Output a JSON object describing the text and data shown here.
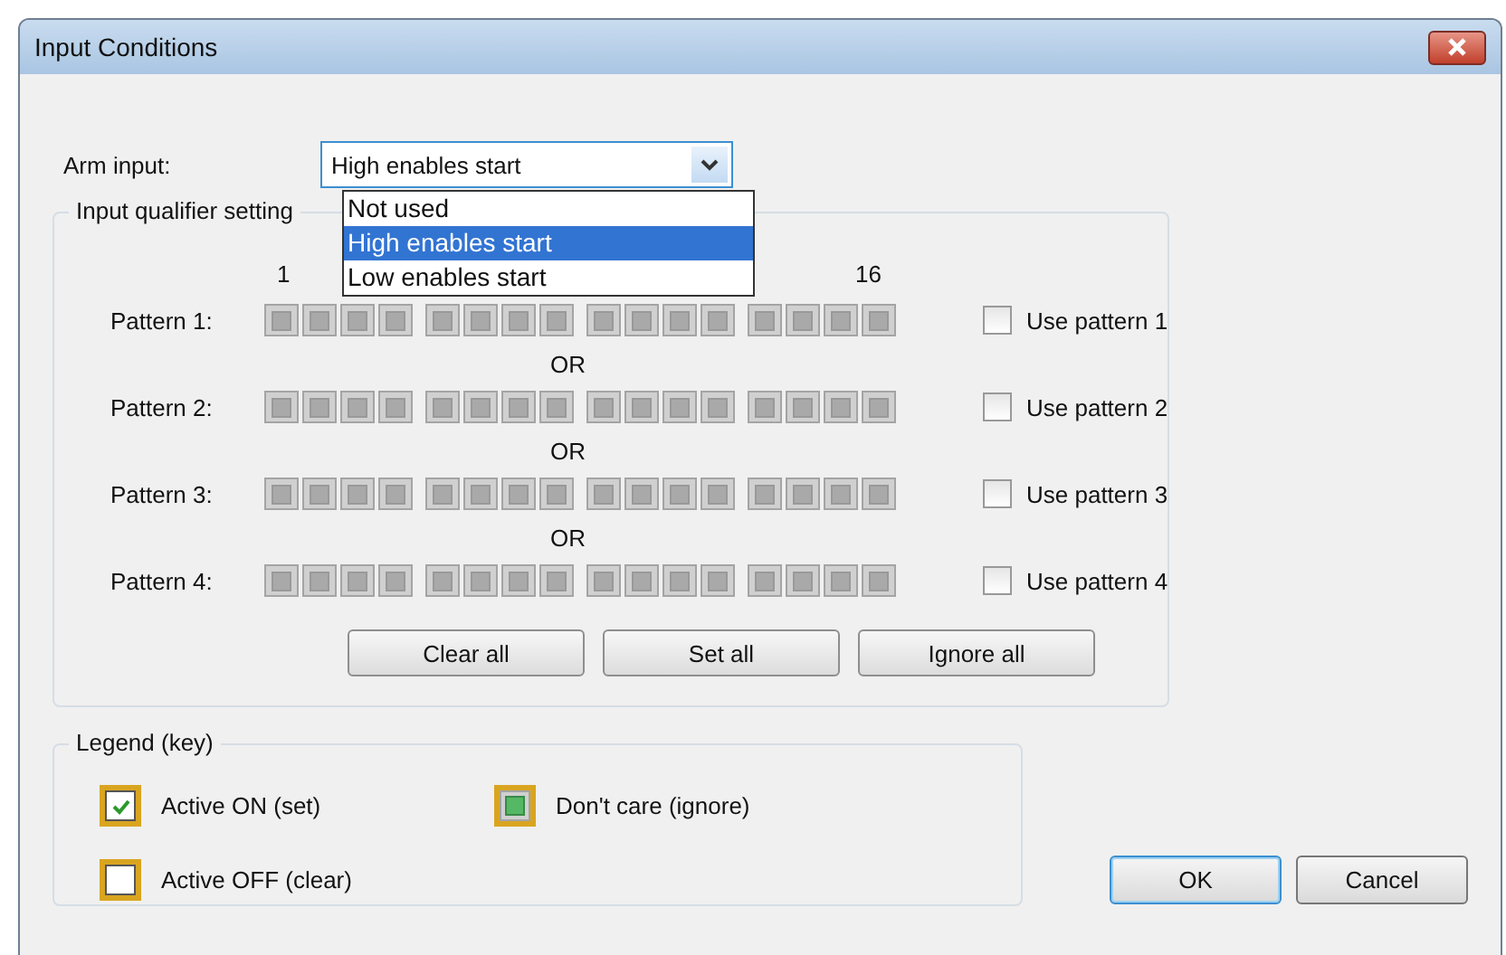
{
  "window": {
    "title": "Input Conditions"
  },
  "arm_input": {
    "label": "Arm input:",
    "value": "High enables start",
    "expanded": true,
    "options": [
      {
        "label": "Not used",
        "selected": false
      },
      {
        "label": "High enables start",
        "selected": true
      },
      {
        "label": "Low enables start",
        "selected": false
      }
    ]
  },
  "qualifier": {
    "title": "Input qualifier setting",
    "first_bit": "1",
    "last_bit": "16",
    "patterns": [
      {
        "label": "Pattern 1:",
        "use_label": "Use pattern 1",
        "checked": false,
        "cells": [
          {
            "kind": "ignore"
          },
          {
            "kind": "ignore"
          },
          {
            "kind": "ignore"
          },
          {
            "kind": "ignore"
          },
          {
            "kind": "ignore"
          },
          {
            "kind": "ignore"
          },
          {
            "kind": "ignore"
          },
          {
            "kind": "ignore"
          },
          {
            "kind": "ignore"
          },
          {
            "kind": "ignore"
          },
          {
            "kind": "ignore"
          },
          {
            "kind": "ignore"
          },
          {
            "kind": "ignore"
          },
          {
            "kind": "ignore"
          },
          {
            "kind": "ignore"
          },
          {
            "kind": "ignore"
          }
        ]
      },
      {
        "separator": "OR",
        "label": "Pattern 2:",
        "use_label": "Use pattern 2",
        "checked": false,
        "cells": [
          {
            "kind": "ignore"
          },
          {
            "kind": "ignore"
          },
          {
            "kind": "ignore"
          },
          {
            "kind": "ignore"
          },
          {
            "kind": "ignore"
          },
          {
            "kind": "ignore"
          },
          {
            "kind": "ignore"
          },
          {
            "kind": "ignore"
          },
          {
            "kind": "ignore"
          },
          {
            "kind": "ignore"
          },
          {
            "kind": "ignore"
          },
          {
            "kind": "ignore"
          },
          {
            "kind": "ignore"
          },
          {
            "kind": "ignore"
          },
          {
            "kind": "ignore"
          },
          {
            "kind": "ignore"
          }
        ]
      },
      {
        "separator": "OR",
        "label": "Pattern 3:",
        "use_label": "Use pattern 3",
        "checked": false,
        "cells": [
          {
            "kind": "ignore"
          },
          {
            "kind": "ignore"
          },
          {
            "kind": "ignore"
          },
          {
            "kind": "ignore"
          },
          {
            "kind": "ignore"
          },
          {
            "kind": "ignore"
          },
          {
            "kind": "ignore"
          },
          {
            "kind": "ignore"
          },
          {
            "kind": "ignore"
          },
          {
            "kind": "ignore"
          },
          {
            "kind": "ignore"
          },
          {
            "kind": "ignore"
          },
          {
            "kind": "ignore"
          },
          {
            "kind": "ignore"
          },
          {
            "kind": "ignore"
          },
          {
            "kind": "ignore"
          }
        ]
      },
      {
        "separator": "OR",
        "label": "Pattern 4:",
        "use_label": "Use pattern 4",
        "checked": false,
        "cells": [
          {
            "kind": "ignore"
          },
          {
            "kind": "ignore"
          },
          {
            "kind": "ignore"
          },
          {
            "kind": "ignore"
          },
          {
            "kind": "ignore"
          },
          {
            "kind": "ignore"
          },
          {
            "kind": "ignore"
          },
          {
            "kind": "ignore"
          },
          {
            "kind": "ignore"
          },
          {
            "kind": "ignore"
          },
          {
            "kind": "ignore"
          },
          {
            "kind": "ignore"
          },
          {
            "kind": "ignore"
          },
          {
            "kind": "ignore"
          },
          {
            "kind": "ignore"
          },
          {
            "kind": "ignore"
          }
        ]
      }
    ],
    "buttons": [
      "Clear all",
      "Set all",
      "Ignore all"
    ]
  },
  "legend": {
    "title": "Legend (key)",
    "items": [
      {
        "kind": "set",
        "label": "Active ON (set)"
      },
      {
        "kind": "ignore",
        "label": "Don't care (ignore)"
      },
      {
        "kind": "clear",
        "label": "Active OFF (clear)"
      }
    ]
  },
  "buttons": [
    {
      "label": "OK",
      "default": true
    },
    {
      "label": "Cancel",
      "default": false
    }
  ]
}
